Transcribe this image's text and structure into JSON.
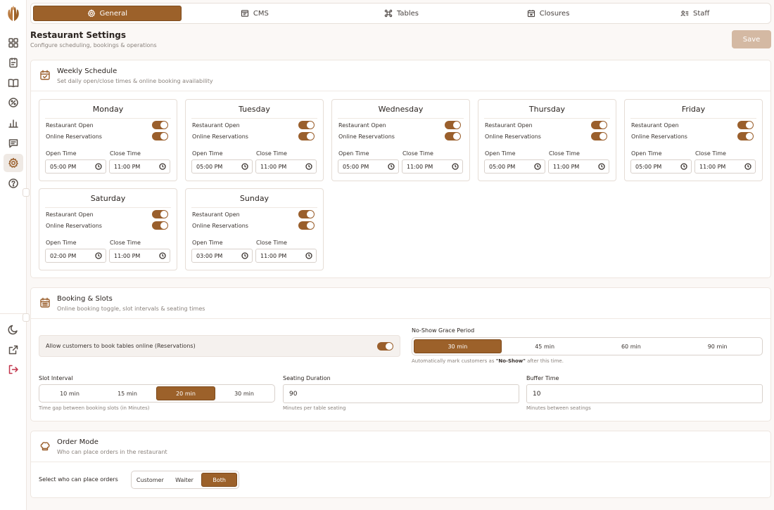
{
  "nav": {
    "tabs": [
      {
        "label": "General",
        "icon": "gear-icon"
      },
      {
        "label": "CMS",
        "icon": "layout-icon"
      },
      {
        "label": "Tables",
        "icon": "tables-icon"
      },
      {
        "label": "Closures",
        "icon": "calendar-icon"
      },
      {
        "label": "Staff",
        "icon": "staff-icon"
      }
    ],
    "active_tab": "General"
  },
  "sidebar": {
    "logo": "hands-logo",
    "items": [
      "dashboard-icon",
      "orders-icon",
      "menu-book-icon",
      "discount-icon",
      "reports-icon",
      "messages-icon",
      "settings-icon",
      "help-icon"
    ],
    "active": "settings-icon",
    "bottom": [
      "theme-moon-icon",
      "external-link-icon",
      "logout-icon"
    ]
  },
  "page": {
    "title": "Restaurant Settings",
    "subtitle": "Configure scheduling, bookings & operations",
    "save_label": "Save"
  },
  "weekly": {
    "title": "Weekly Schedule",
    "subtitle": "Set daily open/close times & online booking availability",
    "labels": {
      "restaurant_open": "Restaurant Open",
      "online_reservations": "Online Reservations",
      "open_time": "Open Time",
      "close_time": "Close Time"
    },
    "days": [
      {
        "name": "Monday",
        "open": "05:00 PM",
        "close": "11:00 PM",
        "restaurant_open": true,
        "online_reservations": true
      },
      {
        "name": "Tuesday",
        "open": "05:00 PM",
        "close": "11:00 PM",
        "restaurant_open": true,
        "online_reservations": true
      },
      {
        "name": "Wednesday",
        "open": "05:00 PM",
        "close": "11:00 PM",
        "restaurant_open": true,
        "online_reservations": true
      },
      {
        "name": "Thursday",
        "open": "05:00 PM",
        "close": "11:00 PM",
        "restaurant_open": true,
        "online_reservations": true
      },
      {
        "name": "Friday",
        "open": "05:00 PM",
        "close": "11:00 PM",
        "restaurant_open": true,
        "online_reservations": true
      },
      {
        "name": "Saturday",
        "open": "02:00 PM",
        "close": "11:00 PM",
        "restaurant_open": true,
        "online_reservations": true
      },
      {
        "name": "Sunday",
        "open": "03:00 PM",
        "close": "11:00 PM",
        "restaurant_open": true,
        "online_reservations": true
      }
    ]
  },
  "booking": {
    "title": "Booking & Slots",
    "subtitle": "Online booking toggle, slot intervals & seating times",
    "allow_label": "Allow customers to book tables online (Reservations)",
    "allow_enabled": true,
    "grace_label": "No-Show Grace Period",
    "grace_options": [
      "30 min",
      "45 min",
      "60 min",
      "90 min"
    ],
    "grace_selected": "30 min",
    "grace_hint_pre": "Automatically mark customers as ",
    "grace_hint_bold": "\"No-Show\"",
    "grace_hint_post": " after this time.",
    "slot_label": "Slot Interval",
    "slot_options": [
      "10 min",
      "15 min",
      "20 min",
      "30 min"
    ],
    "slot_selected": "20 min",
    "slot_hint": "Time gap between booking slots (in Minutes)",
    "seating_label": "Seating Duration",
    "seating_value": "90",
    "seating_hint": "Minutes per table seating",
    "buffer_label": "Buffer Time",
    "buffer_value": "10",
    "buffer_hint": "Minutes between seatings"
  },
  "order_mode": {
    "title": "Order Mode",
    "subtitle": "Who can place orders in the restaurant",
    "select_label": "Select who can place orders",
    "options": [
      "Customer",
      "Waiter",
      "Both"
    ],
    "selected": "Both"
  },
  "colors": {
    "accent": "#9c612a",
    "save_disabled": "#d4b9a3",
    "logout": "#c2334a"
  }
}
